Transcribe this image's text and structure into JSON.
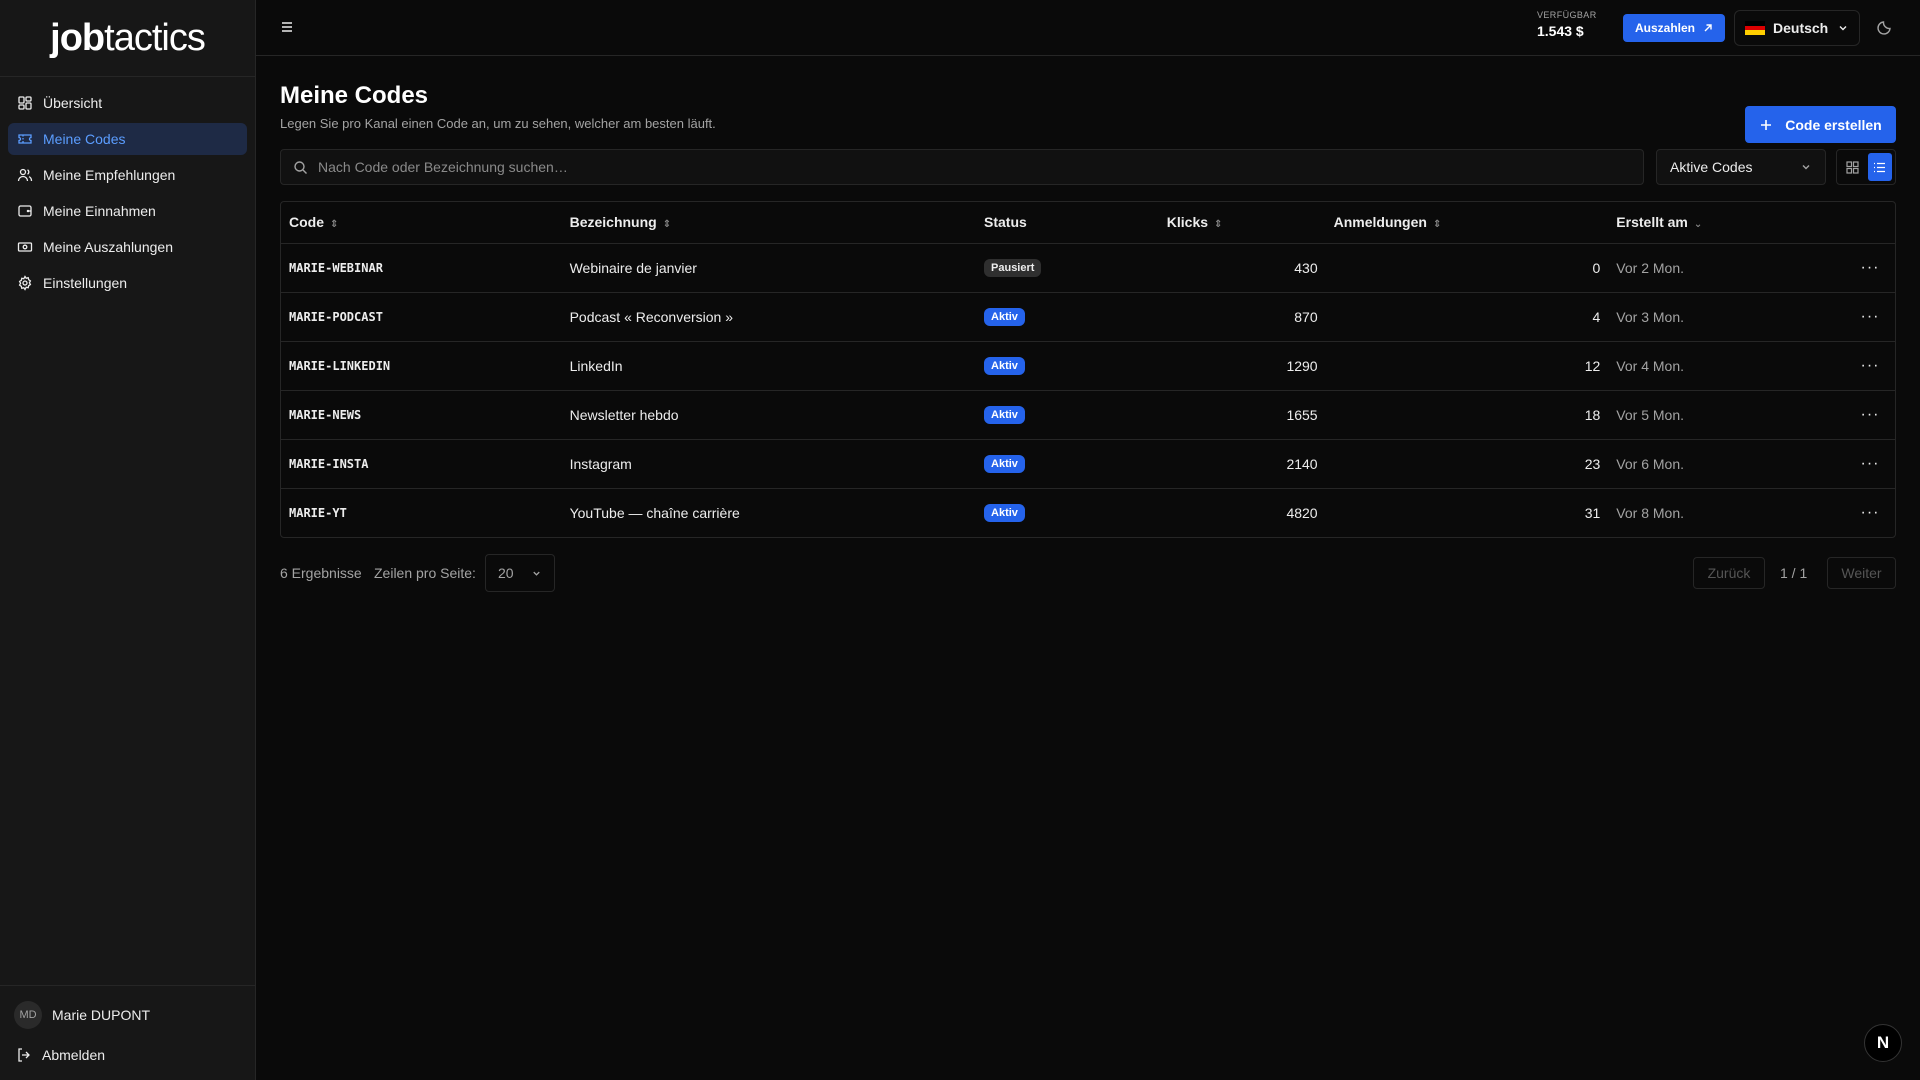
{
  "brand": {
    "logo_bold": "job",
    "logo_light": "tactics"
  },
  "sidebar": {
    "items": [
      {
        "label": "Übersicht",
        "icon": "dashboard-icon",
        "active": false
      },
      {
        "label": "Meine Codes",
        "icon": "ticket-icon",
        "active": true
      },
      {
        "label": "Meine Empfehlungen",
        "icon": "users-icon",
        "active": false
      },
      {
        "label": "Meine Einnahmen",
        "icon": "wallet-icon",
        "active": false
      },
      {
        "label": "Meine Auszahlungen",
        "icon": "banknote-icon",
        "active": false
      },
      {
        "label": "Einstellungen",
        "icon": "gear-icon",
        "active": false
      }
    ],
    "user": {
      "initials": "MD",
      "name": "Marie DUPONT"
    },
    "logout_label": "Abmelden"
  },
  "topbar": {
    "balance_label": "VERFÜGBAR",
    "balance_value": "1.543 $",
    "payout_label": "Auszahlen",
    "language": "Deutsch"
  },
  "page": {
    "title": "Meine Codes",
    "subtitle": "Legen Sie pro Kanal einen Code an, um zu sehen, welcher am besten läuft.",
    "create_label": "Code erstellen"
  },
  "search": {
    "placeholder": "Nach Code oder Bezeichnung suchen…",
    "value": ""
  },
  "filter": {
    "selected": "Aktive Codes"
  },
  "table": {
    "headers": {
      "code": "Code",
      "label": "Bezeichnung",
      "status": "Status",
      "clicks": "Klicks",
      "signups": "Anmeldungen",
      "created": "Erstellt am"
    },
    "rows": [
      {
        "code": "MARIE-WEBINAR",
        "label": "Webinaire de janvier",
        "status": "Pausiert",
        "status_type": "paused",
        "clicks": "430",
        "signups": "0",
        "created": "Vor 2 Mon."
      },
      {
        "code": "MARIE-PODCAST",
        "label": "Podcast « Reconversion »",
        "status": "Aktiv",
        "status_type": "active",
        "clicks": "870",
        "signups": "4",
        "created": "Vor 3 Mon."
      },
      {
        "code": "MARIE-LINKEDIN",
        "label": "LinkedIn",
        "status": "Aktiv",
        "status_type": "active",
        "clicks": "1290",
        "signups": "12",
        "created": "Vor 4 Mon."
      },
      {
        "code": "MARIE-NEWS",
        "label": "Newsletter hebdo",
        "status": "Aktiv",
        "status_type": "active",
        "clicks": "1655",
        "signups": "18",
        "created": "Vor 5 Mon."
      },
      {
        "code": "MARIE-INSTA",
        "label": "Instagram",
        "status": "Aktiv",
        "status_type": "active",
        "clicks": "2140",
        "signups": "23",
        "created": "Vor 6 Mon."
      },
      {
        "code": "MARIE-YT",
        "label": "YouTube — chaîne carrière",
        "status": "Aktiv",
        "status_type": "active",
        "clicks": "4820",
        "signups": "31",
        "created": "Vor 8 Mon."
      }
    ]
  },
  "pagination": {
    "results": "6 Ergebnisse",
    "rows_per_page_label": "Zeilen pro Seite:",
    "rows_per_page": "20",
    "prev_label": "Zurück",
    "page_indicator": "1 / 1",
    "next_label": "Weiter"
  },
  "fab": {
    "label": "N"
  },
  "colors": {
    "accent": "#2563eb",
    "background": "#0a0a0a",
    "sidebar": "#171717",
    "active_nav_text": "#5b9dff"
  }
}
